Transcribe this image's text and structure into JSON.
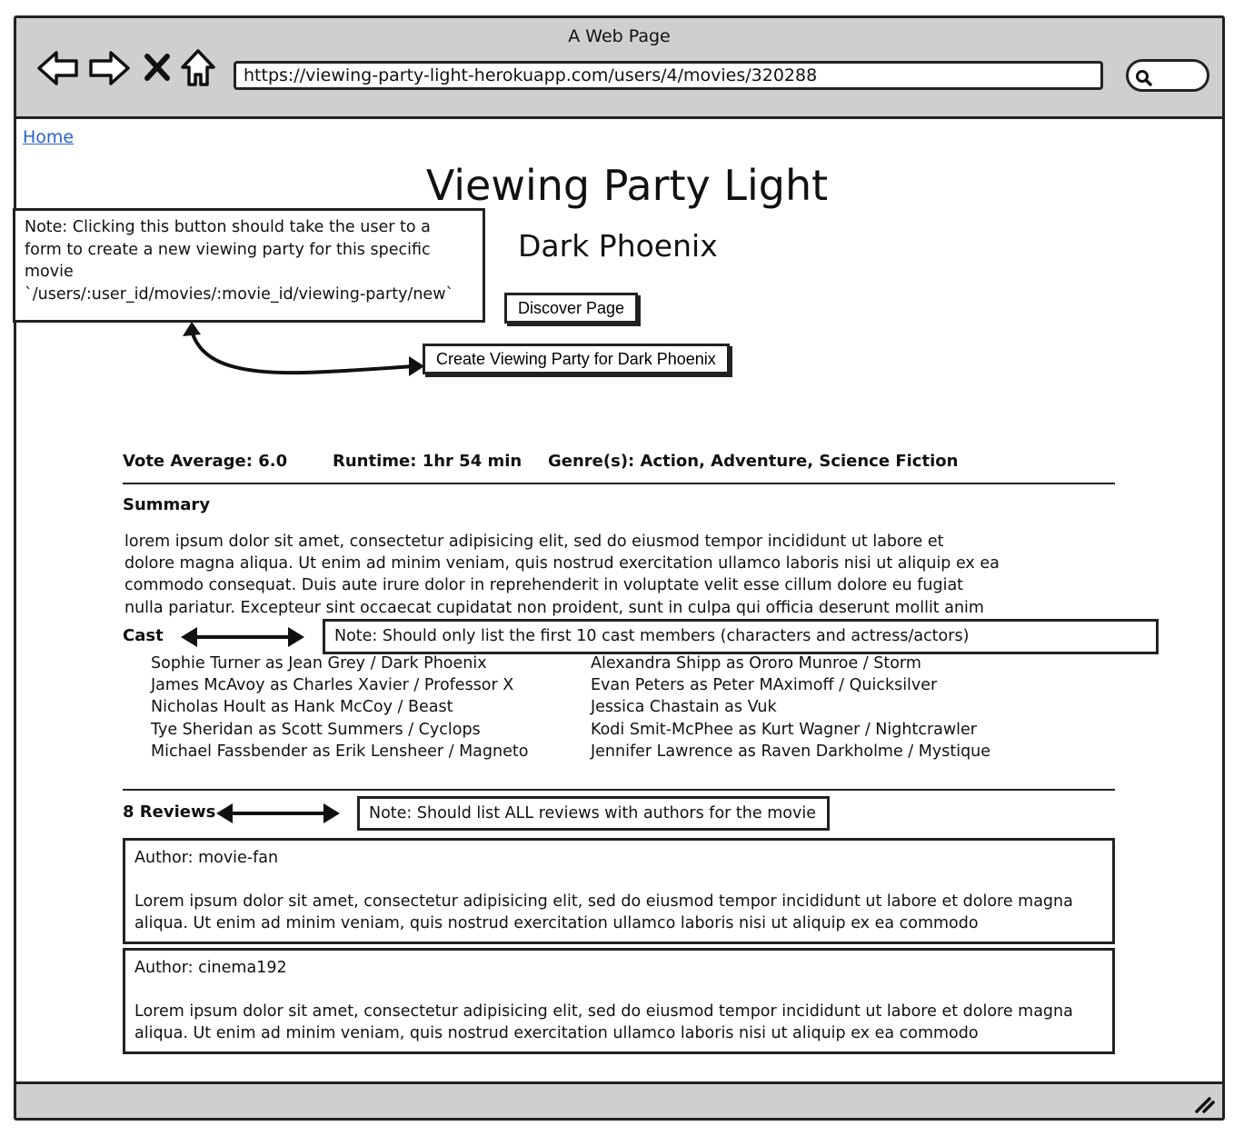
{
  "window": {
    "title": "A Web Page",
    "url": "https://viewing-party-light-herokuapp.com/users/4/movies/320288"
  },
  "nav": {
    "home_label": "Home"
  },
  "page": {
    "app_title": "Viewing Party Light",
    "movie_title": "Dark Phoenix",
    "discover_button": "Discover Page",
    "create_party_button": "Create Viewing Party for Dark Phoenix"
  },
  "notes": {
    "create_party_note_lines": [
      "Note: Clicking this button should take the user to a",
      "form to create a new viewing party for this specific",
      "movie",
      "`/users/:user_id/movies/:movie_id/viewing-party/new`"
    ],
    "cast_note": "Note: Should only list the first 10 cast members (characters and actress/actors)",
    "reviews_note": "Note: Should list ALL reviews with authors for the movie"
  },
  "stats": {
    "vote_average": "Vote Average: 6.0",
    "runtime": "Runtime: 1hr 54 min",
    "genres": "Genre(s): Action, Adventure, Science Fiction"
  },
  "summary": {
    "heading": "Summary",
    "lines": [
      "lorem ipsum dolor sit amet, consectetur adipisicing elit, sed do eiusmod tempor incididunt ut labore et",
      "dolore magna aliqua. Ut enim ad minim veniam, quis nostrud exercitation ullamco laboris nisi ut aliquip ex ea",
      "commodo consequat. Duis aute irure dolor in reprehenderit in voluptate velit esse cillum dolore eu fugiat",
      "nulla pariatur. Excepteur sint occaecat cupidatat non proident, sunt in culpa qui officia deserunt mollit anim"
    ]
  },
  "cast": {
    "heading": "Cast",
    "left_column": [
      "Sophie Turner as Jean Grey / Dark Phoenix",
      "James McAvoy as Charles Xavier / Professor X",
      "Nicholas Hoult as Hank McCoy / Beast",
      "Tye Sheridan as Scott Summers / Cyclops",
      "Michael Fassbender as Erik Lensheer / Magneto"
    ],
    "right_column": [
      "Alexandra Shipp as Ororo Munroe / Storm",
      "Evan Peters as Peter MAximoff / Quicksilver",
      "Jessica Chastain as Vuk",
      "Kodi Smit-McPhee as Kurt Wagner / Nightcrawler",
      "Jennifer Lawrence as Raven Darkholme / Mystique"
    ]
  },
  "reviews": {
    "heading": "8 Reviews",
    "items": [
      {
        "author": "Author: movie-fan",
        "body": "Lorem ipsum dolor sit amet, consectetur adipisicing elit, sed do eiusmod tempor incididunt ut labore et dolore magna aliqua. Ut enim ad minim veniam, quis nostrud exercitation ullamco laboris nisi ut aliquip ex ea commodo"
      },
      {
        "author": "Author: cinema192",
        "body": "Lorem ipsum dolor sit amet, consectetur adipisicing elit, sed do eiusmod tempor incididunt ut labore et dolore magna aliqua. Ut enim ad minim veniam, quis nostrud exercitation ullamco laboris nisi ut aliquip ex ea commodo"
      }
    ]
  },
  "icons": {
    "back": "back-arrow-icon",
    "forward": "forward-arrow-icon",
    "stop": "close-icon",
    "home": "home-icon",
    "search": "search-icon",
    "resize": "resize-grip-icon"
  }
}
